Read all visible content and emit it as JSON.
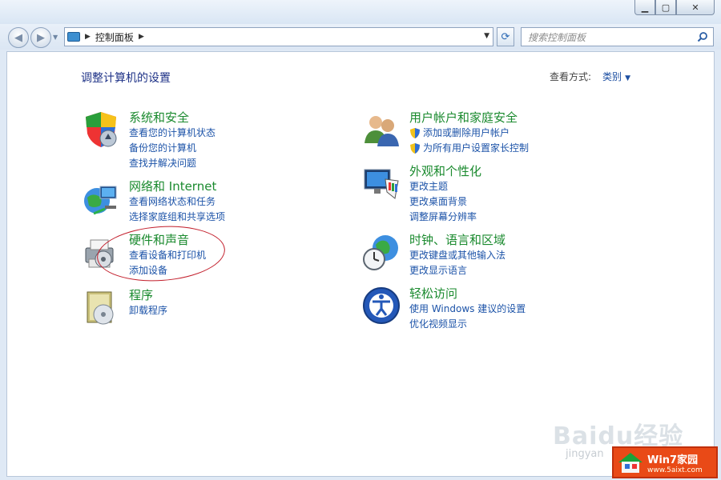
{
  "window": {
    "minimize_glyph": "▁",
    "maximize_glyph": "▢",
    "close_glyph": "✕"
  },
  "nav": {
    "back_glyph": "◀",
    "forward_glyph": "▶",
    "address_arrow_1": "▶",
    "address_text": "控制面板",
    "address_arrow_2": "▶",
    "address_dropdown": "▼",
    "refresh_glyph": "⟳",
    "search_placeholder": "搜索控制面板"
  },
  "content": {
    "title": "调整计算机的设置",
    "view_by_label": "查看方式:",
    "view_by_value": "类别"
  },
  "categories": [
    {
      "title": "系统和安全",
      "links": [
        "查看您的计算机状态",
        "备份您的计算机",
        "查找并解决问题"
      ],
      "icon": "system-security-shield-icon"
    },
    {
      "title": "网络和 Internet",
      "links": [
        "查看网络状态和任务",
        "选择家庭组和共享选项"
      ],
      "icon": "network-globe-icon"
    },
    {
      "title": "硬件和声音",
      "links": [
        "查看设备和打印机",
        "添加设备"
      ],
      "icon": "hardware-printer-icon"
    },
    {
      "title": "程序",
      "links": [
        "卸载程序"
      ],
      "icon": "programs-disc-icon"
    },
    {
      "title": "用户帐户和家庭安全",
      "links": [
        "添加或删除用户帐户",
        "为所有用户设置家长控制"
      ],
      "icon": "user-accounts-icon"
    },
    {
      "title": "外观和个性化",
      "links": [
        "更改主题",
        "更改桌面背景",
        "调整屏幕分辨率"
      ],
      "icon": "appearance-monitor-icon"
    },
    {
      "title": "时钟、语言和区域",
      "links": [
        "更改键盘或其他输入法",
        "更改显示语言"
      ],
      "icon": "clock-globe-icon"
    },
    {
      "title": "轻松访问",
      "links": [
        "使用 Windows 建议的设置",
        "优化视频显示"
      ],
      "icon": "ease-of-access-icon"
    }
  ],
  "watermark": {
    "baidu": "Baidu经验",
    "jingyan": "jingyan",
    "logo_main": "Win7家园",
    "logo_sub": "www.5aixt.com"
  }
}
